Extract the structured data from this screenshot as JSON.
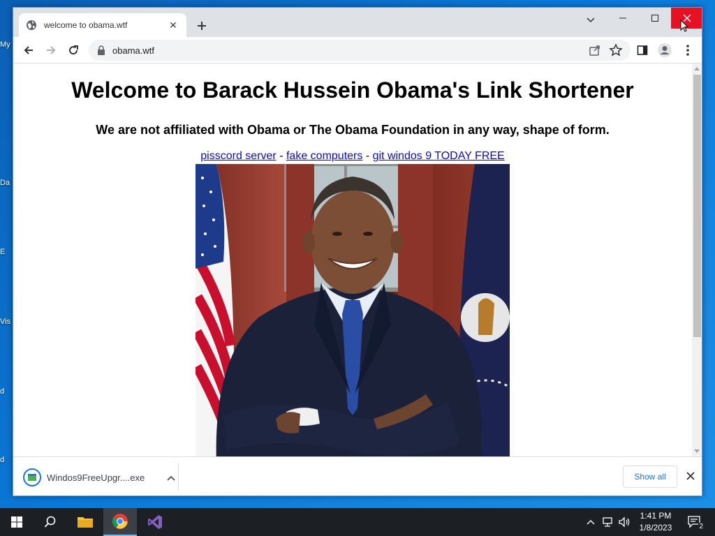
{
  "desktop": {
    "icon_labels": [
      "My",
      "Da",
      "E",
      "Vis",
      "d",
      "d"
    ]
  },
  "browser": {
    "tab": {
      "title": "welcome to obama.wtf"
    },
    "address": {
      "url": "obama.wtf"
    }
  },
  "page": {
    "heading": "Welcome to Barack Hussein Obama's Link Shortener",
    "subheading": "We are not affiliated with Obama or The Obama Foundation in any way, shape of form.",
    "links": [
      {
        "label": "pisscord server"
      },
      {
        "label": "fake computers"
      },
      {
        "label": "git windos 9 TODAY FREE"
      }
    ],
    "separator": " - "
  },
  "downloads": {
    "item_name": "Windos9FreeUpgr....exe",
    "show_all": "Show all"
  },
  "taskbar": {
    "time": "1:41 PM",
    "date": "1/8/2023",
    "notification_count": "2"
  },
  "colors": {
    "close_red": "#e81123",
    "link_blue": "#0b0bcf",
    "accent_blue": "#1a73e8",
    "taskbar": "#1c1f24",
    "desktop": "#0a78d7"
  }
}
